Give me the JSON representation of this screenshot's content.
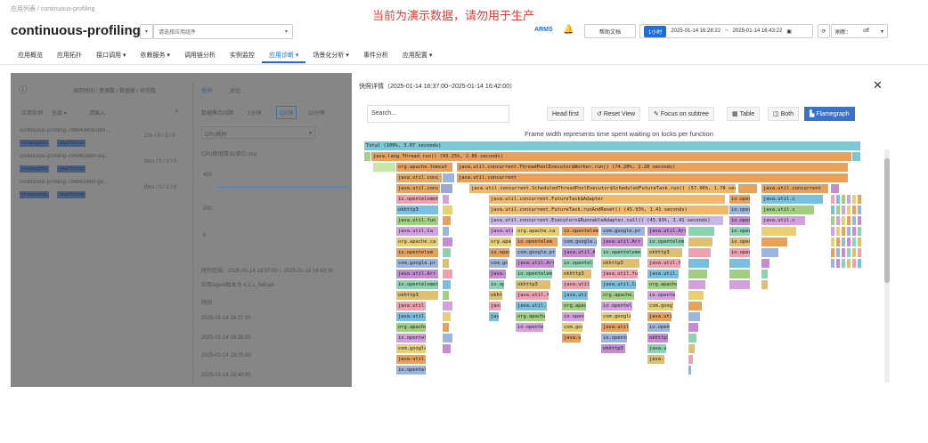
{
  "breadcrumb": {
    "root": "应用列表",
    "current": "continuous-profiling"
  },
  "notice": "当前为演示数据，请勿用于生产",
  "app_title": "continuous-profiling",
  "toolbar": {
    "select_placeholder": "请选择应用组件",
    "help": "帮助文档",
    "tag": "1小时",
    "time_start": "2025-01-14 16:28:22",
    "time_sep": "~",
    "time_end": "2025-01-14 16:43:22",
    "refresh": "刷新：",
    "refresh_value": "off",
    "brand": "ARMS"
  },
  "tabs": [
    "应用概览",
    "应用拓扑",
    "接口调用 ▾",
    "依赖服务 ▾",
    "调用链分析",
    "实例监控",
    "应用诊断 ▾",
    "场景化分析 ▾",
    "事件分析",
    "应用配置 ▾"
  ],
  "left": {
    "header": "调用时间 / 资源数 / 数据量 / 异常数",
    "filter_label": "应用实例",
    "filter_value": "全部",
    "filter_input": "请输入",
    "instances": [
      {
        "name": "continuous-profiling-7d6b4d459-rdm...",
        "stat": "15s / 0 / 3 / 0",
        "tags": [
          "cn-hangzhou",
          "Java/Tomcat"
        ]
      },
      {
        "name": "continuous-profiling-7d494c9dbf-wq...",
        "stat": "0ms / 0 / 2 / 0",
        "tags": [
          "cn-hangzhou",
          "Java/Tomcat"
        ]
      },
      {
        "name": "continuous-profiling-7d494c9dbf-g6...",
        "stat": "0ms / 0 / 2 / 0",
        "tags": [
          "cn-hangzhou",
          "Java/Tomcat"
        ]
      }
    ],
    "subtabs": [
      "查询",
      "对比"
    ],
    "interval_label": "数据聚合间隔",
    "intervals": [
      "1分钟",
      "5分钟",
      "10分钟"
    ],
    "select_cpu": "CPU耗时",
    "chart_title": "CPU使用情况(单位:ms)",
    "y_ticks": [
      "400",
      "200",
      "0"
    ],
    "time_range": "时间范围：2025-01-14 16:07:00 ~ 2025-01-14 16:43:00",
    "agent": "应用Agent版本为 4.2.1_fb6ca6",
    "time_col": "时间",
    "times": [
      "2025-01-14 16:27:00",
      "2025-01-14 16:26:00",
      "2025-01-14 16:25:00",
      "2025-01-14 16:40:00"
    ]
  },
  "modal": {
    "title": "快照详情（2025-01-14 16:37:00~2025-01-14 16:42:00）",
    "search_placeholder": "Search...",
    "buttons": [
      "Head first",
      "Reset View",
      "Focus on subtree",
      "Table",
      "Both",
      "Flamegraph"
    ],
    "caption": "Frame width represents time spent waiting on locks per function",
    "frames": [
      {
        "text": "Total (100%, 3.07 seconds)",
        "level": 0
      },
      {
        "text": "java.lang.Thread.run() (93.25%, 2.86 seconds)",
        "level": 1
      },
      {
        "text": "java.util.concurrent.ThreadPoolExecutor$Worker.run() (74.20%, 2.28 seconds)",
        "level": 2
      },
      {
        "text": "java.util.concurrent.ScheduledThreadPoolExecutor$ScheduledFutureTask.run() (57.96%, 1.78 seconds)",
        "level": 4
      },
      {
        "text": "java.util.concurrent.FutureTask.runAndReset() (45.93%, 1.41 seconds)",
        "level": 6
      },
      {
        "text": "java.util.concurrent.Executors$RunnableAdapter.call() (45.93%, 1.41 seconds)",
        "level": 7
      }
    ]
  },
  "colors": {
    "accent": "#1a6fe0",
    "notice": "#e0403c",
    "overlay": "#868686"
  }
}
